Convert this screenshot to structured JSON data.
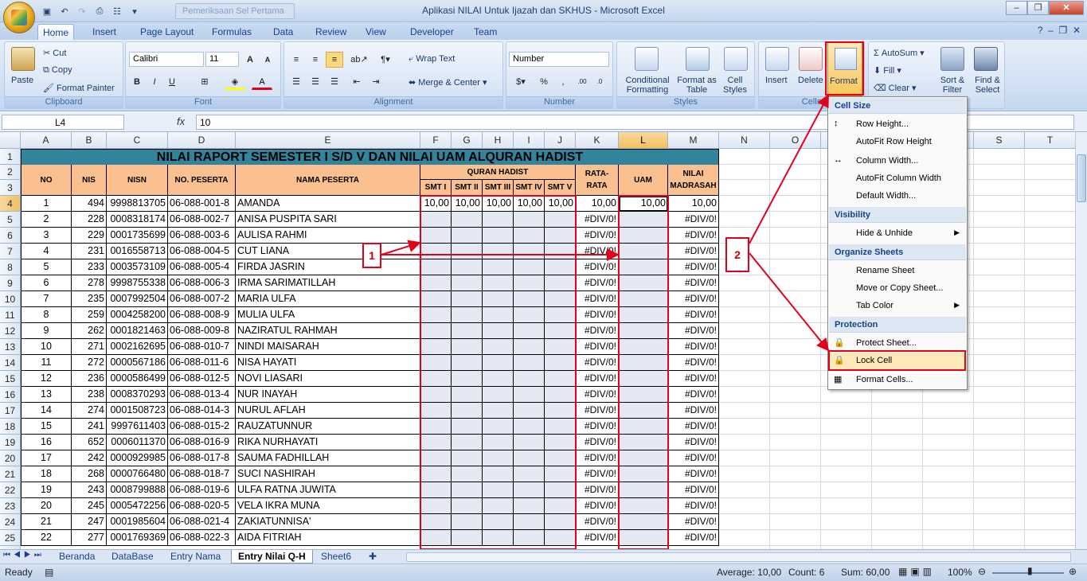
{
  "window": {
    "title": "Aplikasi NILAI Untuk Ijazah dan SKHUS  -  Microsoft Excel",
    "doc_tab": "Pemeriksaan Sel Pertama"
  },
  "menu_tabs": [
    "Home",
    "Insert",
    "Page Layout",
    "Formulas",
    "Data",
    "Review",
    "View",
    "Developer",
    "Team"
  ],
  "ribbon": {
    "clipboard": {
      "label": "Clipboard",
      "paste": "Paste",
      "cut": "Cut",
      "copy": "Copy",
      "format_painter": "Format Painter"
    },
    "font": {
      "label": "Font",
      "name": "Calibri",
      "size": "11"
    },
    "alignment": {
      "label": "Alignment",
      "wrap": "Wrap Text",
      "merge": "Merge & Center"
    },
    "number": {
      "label": "Number",
      "format": "Number"
    },
    "styles": {
      "label": "Styles",
      "conditional": "Conditional Formatting",
      "table": "Format as Table",
      "cell": "Cell Styles"
    },
    "cells": {
      "label": "Cells",
      "insert": "Insert",
      "delete": "Delete",
      "format": "Format"
    },
    "editing": {
      "autosum": "AutoSum",
      "fill": "Fill",
      "clear": "Clear",
      "sort": "Sort & Filter",
      "find": "Find & Select"
    }
  },
  "formula_bar": {
    "name_box": "L4",
    "fx": "fx",
    "value": "10"
  },
  "columns": [
    "A",
    "B",
    "C",
    "D",
    "E",
    "F",
    "G",
    "H",
    "I",
    "J",
    "K",
    "L",
    "M",
    "N",
    "O",
    "P",
    "Q",
    "R",
    "S",
    "T"
  ],
  "sheet": {
    "title": "NILAI RAPORT SEMESTER I S/D V DAN NILAI UAM ALQURAN HADIST",
    "headers": {
      "no": "NO",
      "nis": "NIS",
      "nisn": "NISN",
      "peserta": "NO. PESERTA",
      "nama": "NAMA PESERTA",
      "quran": "QURAN HADIST",
      "smt1": "SMT I",
      "smt2": "SMT II",
      "smt3": "SMT III",
      "smt4": "SMT IV",
      "smt5": "SMT V",
      "rata": "RATA-RATA",
      "uam": "UAM",
      "madrasah": "NILAI MADRASAH"
    },
    "rows": [
      [
        "1",
        "494",
        "9998813705",
        "06-088-001-8",
        "AMANDA",
        "10,00",
        "10,00",
        "10,00",
        "10,00",
        "10,00",
        "10,00",
        "10,00",
        "10,00"
      ],
      [
        "2",
        "228",
        "0008318174",
        "06-088-002-7",
        "ANISA PUSPITA SARI",
        "",
        "",
        "",
        "",
        "",
        "#DIV/0!",
        "",
        "#DIV/0!"
      ],
      [
        "3",
        "229",
        "0001735699",
        "06-088-003-6",
        "AULISA RAHMI",
        "",
        "",
        "",
        "",
        "",
        "#DIV/0!",
        "",
        "#DIV/0!"
      ],
      [
        "4",
        "231",
        "0016558713",
        "06-088-004-5",
        "CUT LIANA",
        "",
        "",
        "",
        "",
        "",
        "#DIV/0!",
        "",
        "#DIV/0!"
      ],
      [
        "5",
        "233",
        "0003573109",
        "06-088-005-4",
        "FIRDA JASRIN",
        "",
        "",
        "",
        "",
        "",
        "#DIV/0!",
        "",
        "#DIV/0!"
      ],
      [
        "6",
        "278",
        "9998755338",
        "06-088-006-3",
        "IRMA SARIMATILLAH",
        "",
        "",
        "",
        "",
        "",
        "#DIV/0!",
        "",
        "#DIV/0!"
      ],
      [
        "7",
        "235",
        "0007992504",
        "06-088-007-2",
        "MARIA ULFA",
        "",
        "",
        "",
        "",
        "",
        "#DIV/0!",
        "",
        "#DIV/0!"
      ],
      [
        "8",
        "259",
        "0004258200",
        "06-088-008-9",
        "MULIA ULFA",
        "",
        "",
        "",
        "",
        "",
        "#DIV/0!",
        "",
        "#DIV/0!"
      ],
      [
        "9",
        "262",
        "0001821463",
        "06-088-009-8",
        "NAZIRATUL RAHMAH",
        "",
        "",
        "",
        "",
        "",
        "#DIV/0!",
        "",
        "#DIV/0!"
      ],
      [
        "10",
        "271",
        "0002162695",
        "06-088-010-7",
        "NINDI MAISARAH",
        "",
        "",
        "",
        "",
        "",
        "#DIV/0!",
        "",
        "#DIV/0!"
      ],
      [
        "11",
        "272",
        "0000567186",
        "06-088-011-6",
        "NISA HAYATI",
        "",
        "",
        "",
        "",
        "",
        "#DIV/0!",
        "",
        "#DIV/0!"
      ],
      [
        "12",
        "236",
        "0000586499",
        "06-088-012-5",
        "NOVI LIASARI",
        "",
        "",
        "",
        "",
        "",
        "#DIV/0!",
        "",
        "#DIV/0!"
      ],
      [
        "13",
        "238",
        "0008370293",
        "06-088-013-4",
        "NUR INAYAH",
        "",
        "",
        "",
        "",
        "",
        "#DIV/0!",
        "",
        "#DIV/0!"
      ],
      [
        "14",
        "274",
        "0001508723",
        "06-088-014-3",
        "NURUL AFLAH",
        "",
        "",
        "",
        "",
        "",
        "#DIV/0!",
        "",
        "#DIV/0!"
      ],
      [
        "15",
        "241",
        "9997611403",
        "06-088-015-2",
        "RAUZATUNNUR",
        "",
        "",
        "",
        "",
        "",
        "#DIV/0!",
        "",
        "#DIV/0!"
      ],
      [
        "16",
        "652",
        "0006011370",
        "06-088-016-9",
        "RIKA NURHAYATI",
        "",
        "",
        "",
        "",
        "",
        "#DIV/0!",
        "",
        "#DIV/0!"
      ],
      [
        "17",
        "242",
        "0000929985",
        "06-088-017-8",
        "SAUMA FADHILLAH",
        "",
        "",
        "",
        "",
        "",
        "#DIV/0!",
        "",
        "#DIV/0!"
      ],
      [
        "18",
        "268",
        "0000766480",
        "06-088-018-7",
        "SUCI NASHIRAH",
        "",
        "",
        "",
        "",
        "",
        "#DIV/0!",
        "",
        "#DIV/0!"
      ],
      [
        "19",
        "243",
        "0008799888",
        "06-088-019-6",
        "ULFA RATNA JUWITA",
        "",
        "",
        "",
        "",
        "",
        "#DIV/0!",
        "",
        "#DIV/0!"
      ],
      [
        "20",
        "245",
        "0005472256",
        "06-088-020-5",
        "VELA IKRA MUNA",
        "",
        "",
        "",
        "",
        "",
        "#DIV/0!",
        "",
        "#DIV/0!"
      ],
      [
        "21",
        "247",
        "0001985604",
        "06-088-021-4",
        "ZAKIATUNNISA'",
        "",
        "",
        "",
        "",
        "",
        "#DIV/0!",
        "",
        "#DIV/0!"
      ],
      [
        "22",
        "277",
        "0001769369",
        "06-088-022-3",
        "AIDA FITRIAH",
        "",
        "",
        "",
        "",
        "",
        "#DIV/0!",
        "",
        "#DIV/0!"
      ]
    ]
  },
  "callouts": {
    "one": "1",
    "two": "2"
  },
  "format_menu": {
    "sections": [
      "Cell Size",
      "Visibility",
      "Organize Sheets",
      "Protection"
    ],
    "items": [
      "Row Height...",
      "AutoFit Row Height",
      "Column Width...",
      "AutoFit Column Width",
      "Default Width...",
      "Hide & Unhide",
      "Rename Sheet",
      "Move or Copy Sheet...",
      "Tab Color",
      "Protect Sheet...",
      "Lock Cell",
      "Format Cells..."
    ]
  },
  "sheet_tabs": [
    "Beranda",
    "DataBase",
    "Entry Nama",
    "Entry Nilai Q-H",
    "Sheet6"
  ],
  "status": {
    "ready": "Ready",
    "average": "Average: 10,00",
    "count": "Count: 6",
    "sum": "Sum: 60,00",
    "zoom": "100%"
  },
  "colors": {
    "title_fill": "#31849b",
    "header_fill": "#fac090",
    "empty_fill": "#e4e8f3",
    "annotation": "#e3001b"
  }
}
